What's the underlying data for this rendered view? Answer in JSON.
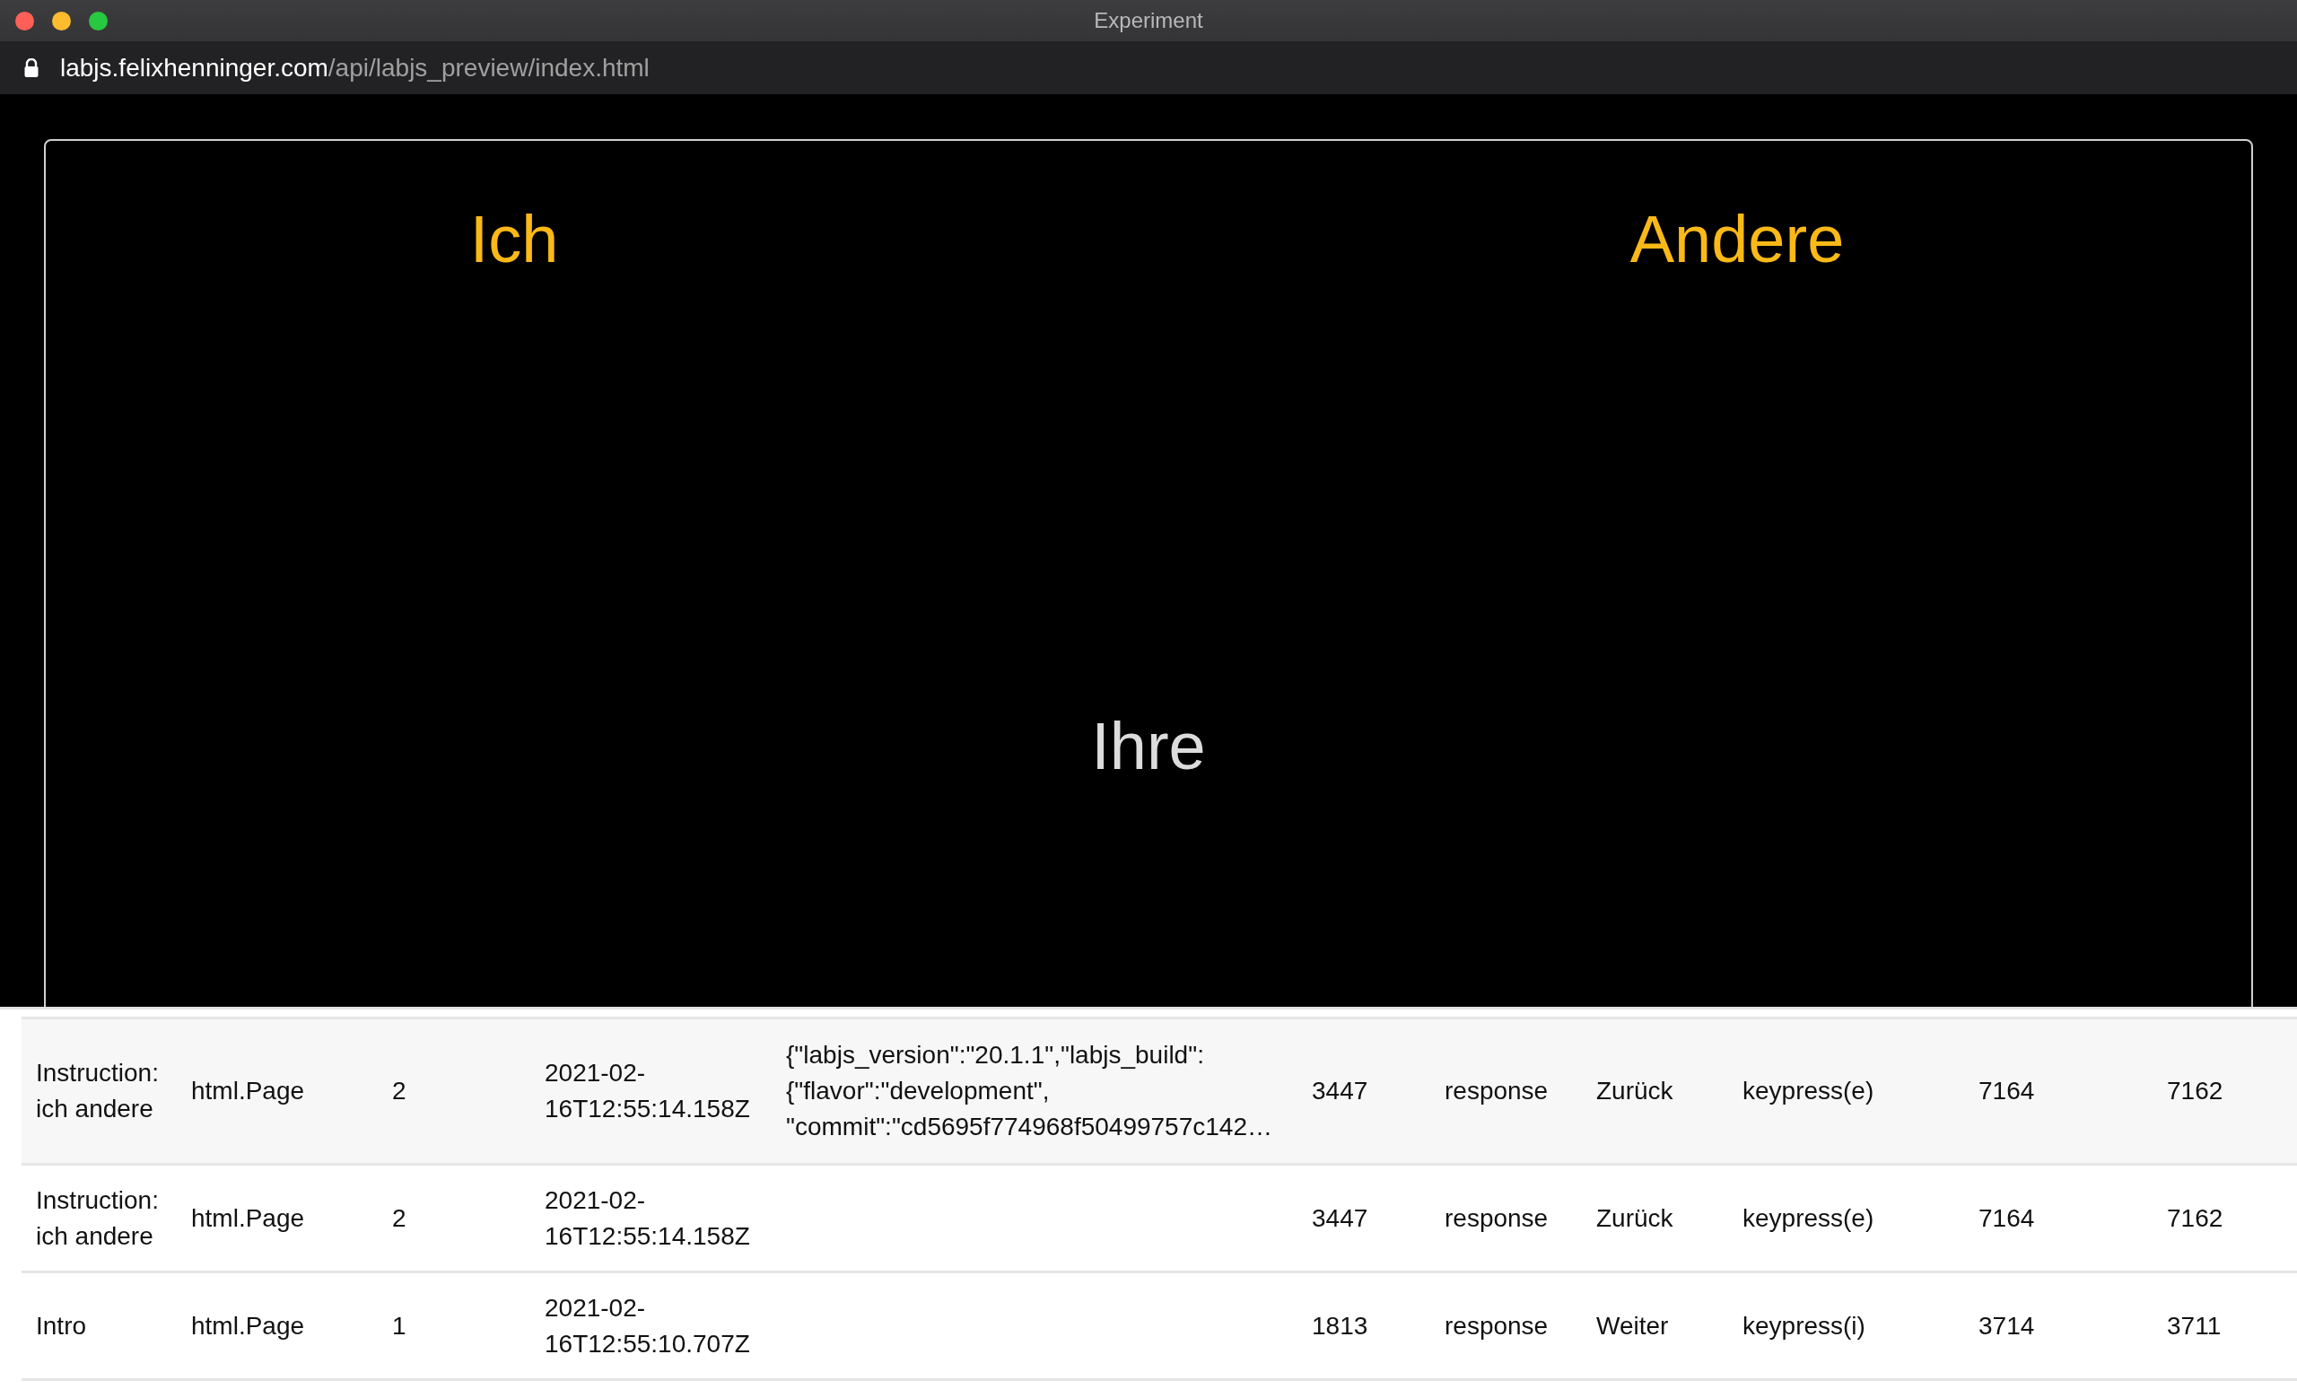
{
  "window": {
    "title": "Experiment"
  },
  "address_bar": {
    "host": "labjs.felixhenninger.com",
    "path": "/api/labjs_preview/index.html"
  },
  "stimulus": {
    "left_label": "Ich",
    "right_label": "Andere",
    "word": "Ihre"
  },
  "table": {
    "rows": [
      {
        "selected": true,
        "cells": [
          "Instruction:\nich andere",
          "html.Page",
          "2",
          "2021-02-\n16T12:55:14.158Z",
          "{\"labjs_version\":\"20.1.1\",\"labjs_build\":\n{\"flavor\":\"development\",\n\"commit\":\"cd5695f774968f50499757c142…",
          "3447",
          "response",
          "Zurück",
          "keypress(e)",
          "7164",
          "7162"
        ]
      },
      {
        "selected": false,
        "cells": [
          "Instruction:\nich andere",
          "html.Page",
          "2",
          "2021-02-\n16T12:55:14.158Z",
          "",
          "3447",
          "response",
          "Zurück",
          "keypress(e)",
          "7164",
          "7162"
        ]
      },
      {
        "selected": false,
        "cells": [
          "Intro",
          "html.Page",
          "1",
          "2021-02-\n16T12:55:10.707Z",
          "",
          "1813",
          "response",
          "Weiter",
          "keypress(i)",
          "3714",
          "3711"
        ]
      }
    ]
  }
}
